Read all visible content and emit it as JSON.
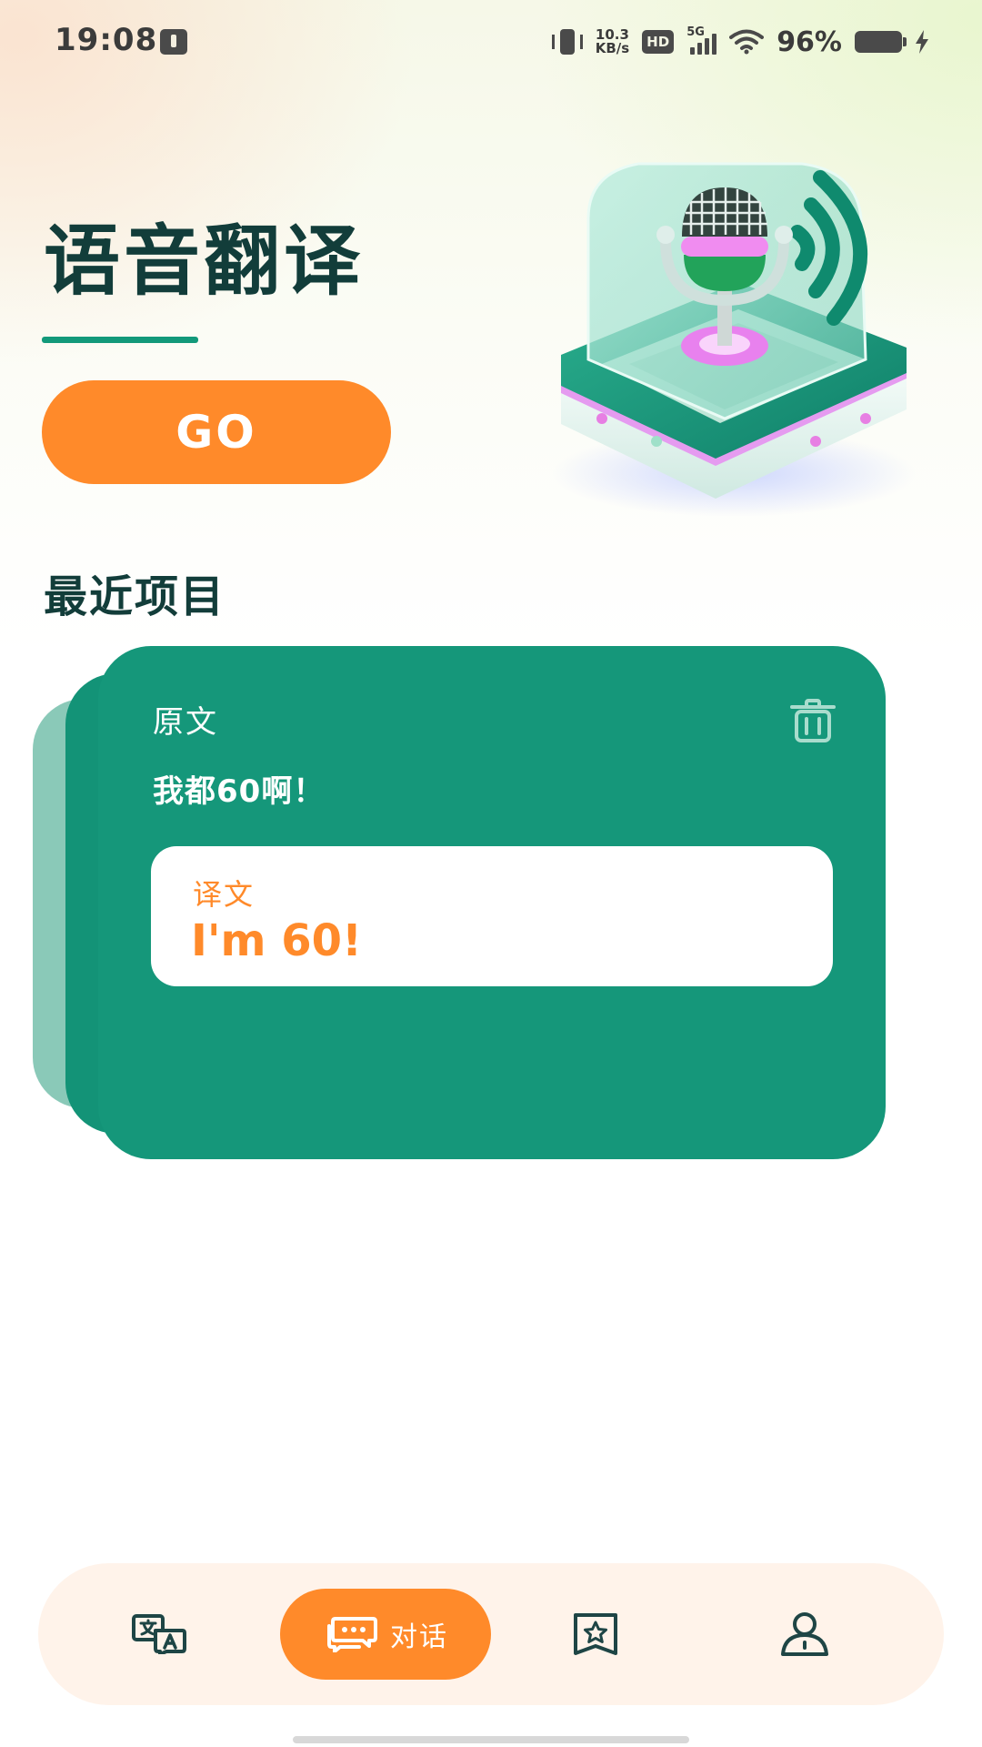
{
  "status_bar": {
    "time": "19:08",
    "net_speed_value": "10.3",
    "net_speed_unit": "KB/s",
    "hd_badge": "HD",
    "network_type": "5G",
    "battery_percent": "96%",
    "icons": [
      "usb-debug-icon",
      "vibrate-icon",
      "signal-icon",
      "wifi-icon",
      "battery-icon",
      "charging-icon"
    ]
  },
  "hero": {
    "title": "语音翻译",
    "go_label": "GO",
    "accent_color": "#12997a",
    "button_color": "#ff8a2a"
  },
  "recent": {
    "section_title": "最近项目",
    "card": {
      "source_label": "原文",
      "source_text": "我都60啊！",
      "translation_label": "译文",
      "translation_text": "I'm 60!",
      "card_color": "#15977a",
      "delete_icon": "trash-icon"
    }
  },
  "bottom_nav": {
    "items": [
      {
        "id": "translate",
        "icon": "text-translate-icon",
        "label": "",
        "active": false
      },
      {
        "id": "dialog",
        "icon": "chat-bubbles-icon",
        "label": "对话",
        "active": true
      },
      {
        "id": "favorites",
        "icon": "star-bookmark-icon",
        "label": "",
        "active": false
      },
      {
        "id": "profile",
        "icon": "user-icon",
        "label": "",
        "active": false
      }
    ],
    "active_color": "#ff8a2a",
    "background_color": "#fff3ea"
  }
}
